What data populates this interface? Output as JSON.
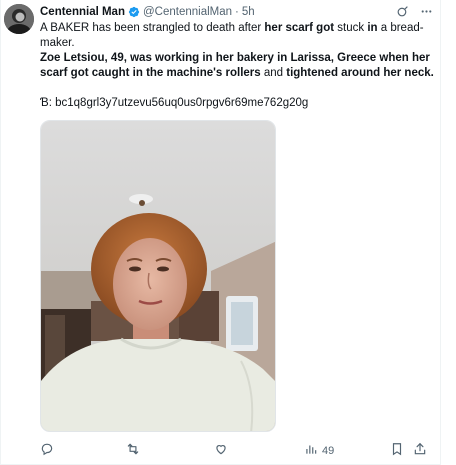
{
  "tweet": {
    "author_name": "Centennial Man",
    "handle": "@CentennialMan",
    "separator": "·",
    "time": "5h",
    "text": {
      "line1_a": "A BAKER has been strangled to death after ",
      "line1_b": "her scarf got",
      "line1_c": " stuck ",
      "line1_d": "in",
      "line1_e": " a bread-maker.",
      "para2_a": "Zoe Letsiou, 49, was working in her bakery in Larissa, Greece when her scarf got caught in the machine's rollers",
      "para2_b": " and ",
      "para2_c": "tightened around her neck.",
      "code_line": "Ɓ: bc1q8grl3y7utzevu56uq0us0rpgv6r69me762g20g"
    },
    "views": "49"
  },
  "icons": {
    "verified": "verified-badge-icon",
    "grok": "grok-icon",
    "more": "more-icon",
    "reply": "reply-icon",
    "retweet": "retweet-icon",
    "like": "like-icon",
    "views": "views-icon",
    "bookmark": "bookmark-icon",
    "share": "share-icon"
  },
  "colors": {
    "text": "#0f1419",
    "muted": "#536471",
    "verified": "#1d9bf0",
    "border": "#eff3f4"
  }
}
